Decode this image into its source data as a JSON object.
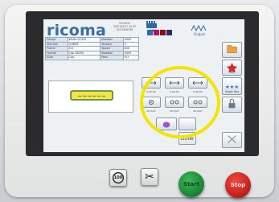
{
  "brand": {
    "logo": "ricoma",
    "accent": "#3a6fa4"
  },
  "header": {
    "line1": "TC1501S",
    "line2": "2021/04/27 10:30",
    "line3": "0123456789"
  },
  "status_table": [
    [
      "Design",
      "White GOOD",
      "Needles",
      "0000"
    ],
    [
      "Stitches",
      "0/3898",
      "Tension",
      "4"
    ],
    [
      "Frame",
      "X:0",
      "Speed",
      "850"
    ],
    [
      "Format",
      "Cap 2809S",
      "Rotation",
      "0000"
    ],
    [
      "Auto",
      "Cap",
      "Pass",
      "0/1"
    ]
  ],
  "preview": {
    "label": "design-preview"
  },
  "top_tabs": {
    "bar_count": 4,
    "tab_label": "Output"
  },
  "center_buttons": [
    {
      "label": "0.00:00"
    },
    {
      "label": "0.00:00"
    },
    {
      "label": "0.00:00"
    },
    {
      "label": "25.0/27"
    },
    {
      "label": "25.0/27"
    },
    {
      "label": "25.0/27"
    }
  ],
  "side_buttons": [
    {
      "label": "",
      "icon": "folder-icon"
    },
    {
      "label": "Fav",
      "icon": "star-icon"
    },
    {
      "label": "Single Star",
      "icon": "stars-icon"
    },
    {
      "label": "",
      "icon": "lock-icon"
    },
    {
      "label": "",
      "icon": "cross-arrows-icon"
    }
  ],
  "other_button": "Other",
  "hardware": {
    "left_button": "100",
    "right_button": "✂",
    "start": "Start",
    "stop": "Stop"
  },
  "colors": {
    "start": "#1d8a3a",
    "stop": "#c8231f",
    "highlight": "#f2e600"
  }
}
